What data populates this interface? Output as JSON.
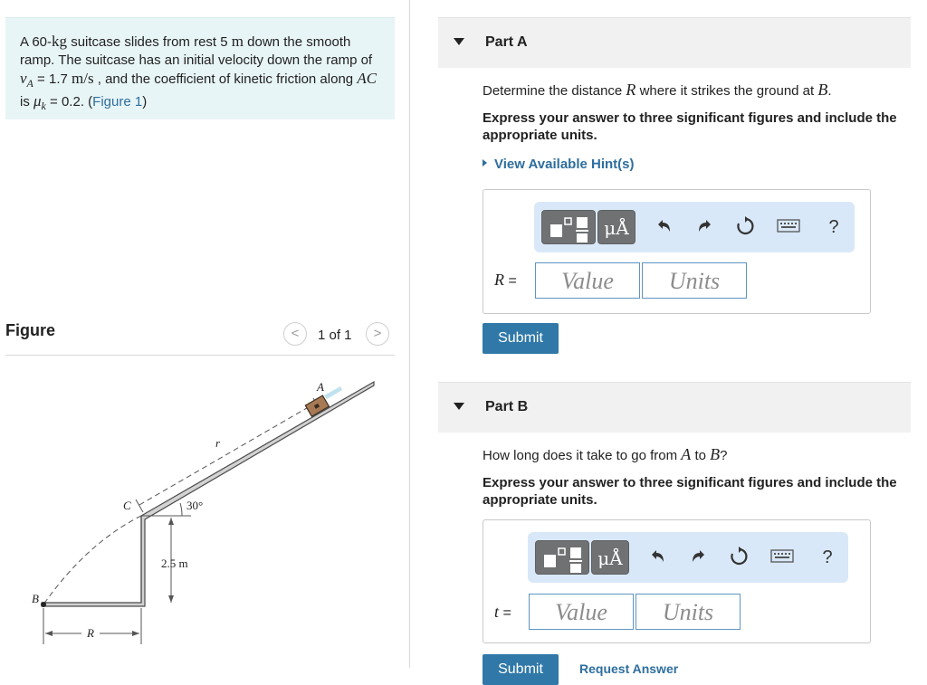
{
  "problem": {
    "t1": "A 60-",
    "kg": "kg",
    "t2": " suitcase slides from rest 5 ",
    "m": "m",
    "t3": " down the smooth ramp. The suitcase has an initial velocity down the ramp of ",
    "vA": "v",
    "vA_sub": "A",
    "t4": " = 1.7 ",
    "ms": "m/s",
    "t5": " , and the coefficient of kinetic friction along ",
    "AC": "AC",
    "t6": " is ",
    "mu": "μ",
    "mu_sub": "k",
    "t7": " = 0.2. (",
    "fig_link": "Figure 1",
    "t8": ")"
  },
  "figure": {
    "title": "Figure",
    "pager": "1 of 1",
    "prev_glyph": "<",
    "next_glyph": ">",
    "labels": {
      "A": "A",
      "r": "r",
      "C": "C",
      "angle": "30°",
      "height": "2.5 m",
      "B": "B",
      "R": "R"
    }
  },
  "partA": {
    "label": "Part A",
    "q_pre": "Determine the distance ",
    "q_var": "R",
    "q_mid": " where it strikes the ground at ",
    "q_var2": "B",
    "q_end": ".",
    "instructions": "Express your answer to three significant figures and include the appropriate units.",
    "hints": "View Available Hint(s)",
    "var": "R",
    "eq": " =",
    "value_placeholder": "Value",
    "units_placeholder": "Units",
    "submit": "Submit"
  },
  "partB": {
    "label": "Part B",
    "q_pre": "How long does it take to go from ",
    "q_var": "A",
    "q_mid": " to ",
    "q_var2": "B",
    "q_end": "?",
    "instructions": "Express your answer to three significant figures and include the appropriate units.",
    "var": "t",
    "eq": " =",
    "value_placeholder": "Value",
    "units_placeholder": "Units",
    "submit": "Submit",
    "request_answer": "Request Answer"
  },
  "toolbar": {
    "unit_symbol": "μÅ",
    "help": "?"
  },
  "colors": {
    "link": "#2e6e9e",
    "submit_bg": "#2f78a8",
    "toolbar_bg": "#d9e8f8",
    "problem_bg": "#e8f5f7"
  }
}
